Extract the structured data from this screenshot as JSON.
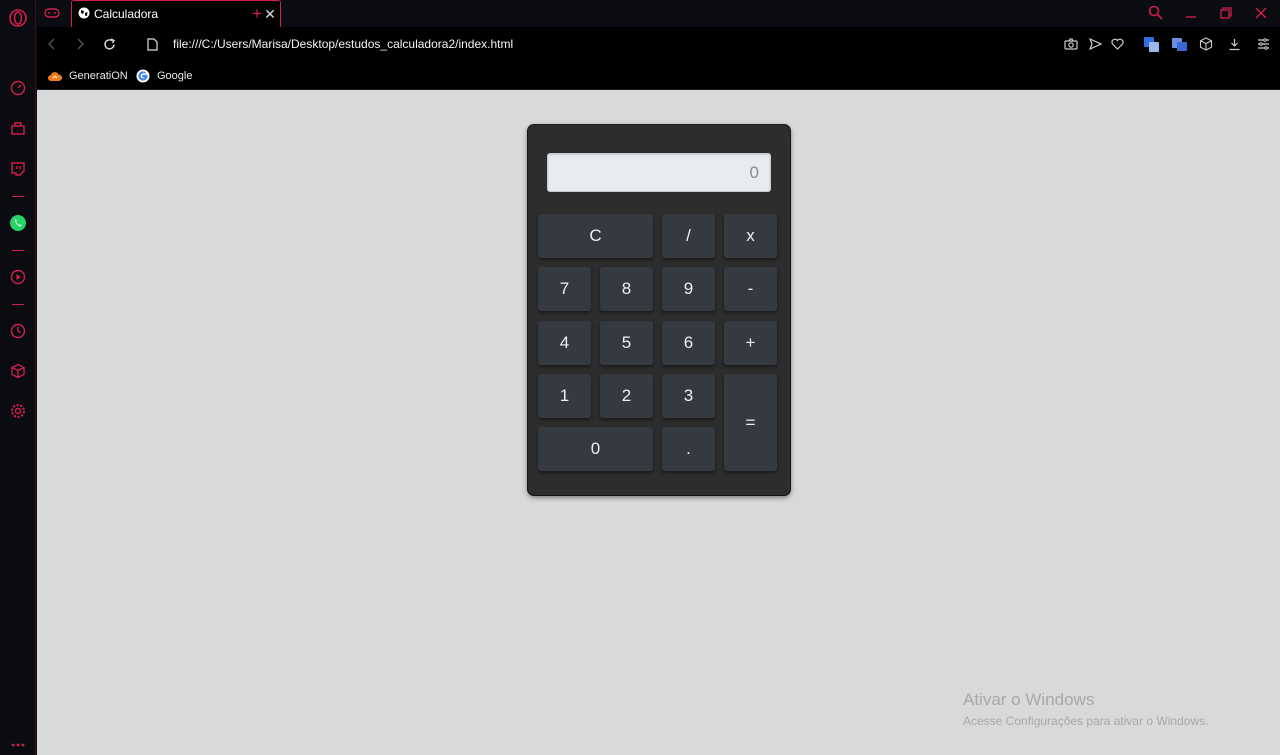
{
  "browser": {
    "tab": {
      "title": "Calculadora"
    },
    "address": {
      "url": "file:///C:/Users/Marisa/Desktop/estudos_calculadora2/index.html"
    },
    "bookmarks": [
      {
        "label": "GeneratiON",
        "icon": "cloud-icon"
      },
      {
        "label": "Google",
        "icon": "google-icon"
      }
    ],
    "accent_color": "#d0204a"
  },
  "calculator": {
    "display": "0",
    "keys": {
      "clear": "C",
      "divide": "/",
      "multiply": "x",
      "seven": "7",
      "eight": "8",
      "nine": "9",
      "minus": "-",
      "four": "4",
      "five": "5",
      "six": "6",
      "plus": "+",
      "one": "1",
      "two": "2",
      "three": "3",
      "equals": "=",
      "zero": "0",
      "dot": "."
    },
    "key_color": "#343a40",
    "body_color": "#2d2d2d"
  },
  "watermark": {
    "title": "Ativar o Windows",
    "subtitle": "Acesse Configurações para ativar o Windows."
  }
}
